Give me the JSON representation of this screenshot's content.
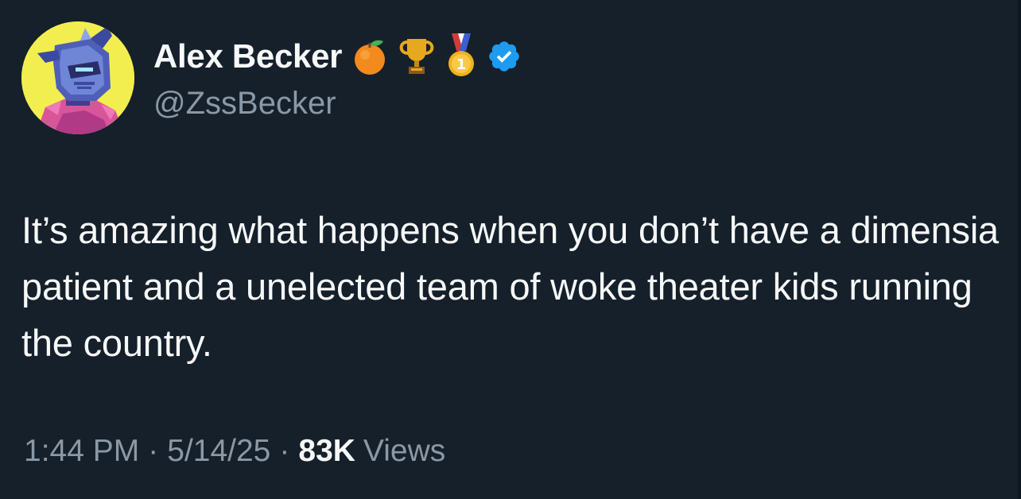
{
  "author": {
    "display_name": "Alex Becker",
    "handle": "@ZssBecker",
    "badges": [
      "orange-icon",
      "trophy-icon",
      "gold-medal-icon",
      "verified-badge-icon"
    ]
  },
  "tweet": {
    "text": "It’s amazing what happens when you don’t have a dimensia patient and a unelected team of woke theater kids running the country."
  },
  "meta": {
    "time": "1:44 PM",
    "separator": "·",
    "date": "5/14/25",
    "views_count": "83K",
    "views_label": "Views"
  },
  "colors": {
    "background": "#15202b",
    "primary_text": "#f7f9f9",
    "secondary_text": "#8b98a5",
    "verified_blue": "#1d9bf0"
  }
}
